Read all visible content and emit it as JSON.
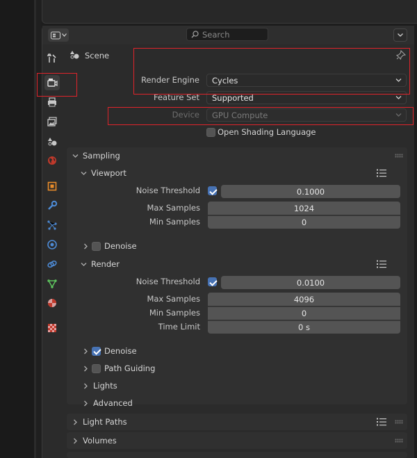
{
  "header": {
    "search_placeholder": "Search"
  },
  "scene": {
    "label": "Scene"
  },
  "render": {
    "engine_label": "Render Engine",
    "engine_value": "Cycles",
    "feature_set_label": "Feature Set",
    "feature_set_value": "Supported",
    "device_label": "Device",
    "device_value": "GPU Compute",
    "osl_label": "Open Shading Language"
  },
  "sampling": {
    "title": "Sampling",
    "viewport": {
      "title": "Viewport",
      "noise_threshold_label": "Noise Threshold",
      "noise_threshold_value": "0.1000",
      "max_samples_label": "Max Samples",
      "max_samples_value": "1024",
      "min_samples_label": "Min Samples",
      "min_samples_value": "0",
      "denoise_label": "Denoise"
    },
    "render": {
      "title": "Render",
      "noise_threshold_label": "Noise Threshold",
      "noise_threshold_value": "0.0100",
      "max_samples_label": "Max Samples",
      "max_samples_value": "4096",
      "min_samples_label": "Min Samples",
      "min_samples_value": "0",
      "time_limit_label": "Time Limit",
      "time_limit_value": "0 s",
      "denoise_label": "Denoise",
      "path_guiding_label": "Path Guiding",
      "lights_label": "Lights",
      "advanced_label": "Advanced"
    }
  },
  "panels": {
    "light_paths": "Light Paths",
    "volumes": "Volumes"
  },
  "colors": {
    "highlight": "#e0242b",
    "checkbox_on": "#4772b3"
  }
}
